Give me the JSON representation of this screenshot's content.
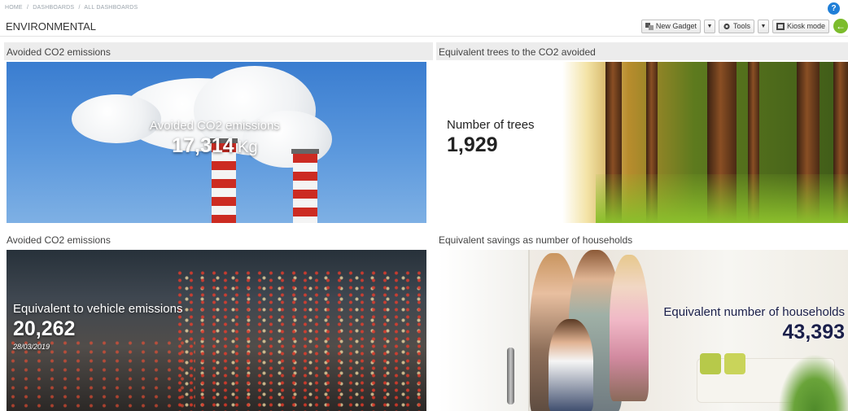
{
  "breadcrumb": [
    "HOME",
    "DASHBOARDS",
    "ALL DASHBOARDS"
  ],
  "breadcrumb_sep": "/",
  "help_label": "?",
  "page_title": "ENVIRONMENTAL",
  "toolbar": {
    "new_gadget": "New Gadget",
    "tools": "Tools",
    "kiosk_mode": "Kiosk mode",
    "caret": "▼",
    "back_icon": "←"
  },
  "panels": [
    {
      "title": "Avoided CO2 emissions",
      "label": "Avoided CO2 emissions",
      "value": "17,314",
      "unit": "Kg",
      "image": "smokestacks"
    },
    {
      "title": "Equivalent trees to the CO2 avoided",
      "label": "Number of trees",
      "value": "1,929",
      "image": "forest"
    },
    {
      "title": "Avoided CO2 emissions",
      "label": "Equivalent to vehicle emissions",
      "value": "20,262",
      "date": "28/03/2019",
      "image": "traffic"
    },
    {
      "title": "Equivalent savings as number of households",
      "label": "Equivalent number of households",
      "value": "43,393",
      "image": "family-home"
    }
  ],
  "colors": {
    "help": "#1f7fd8",
    "back": "#7cbc2c",
    "dark_value": "#1a1f4a"
  }
}
